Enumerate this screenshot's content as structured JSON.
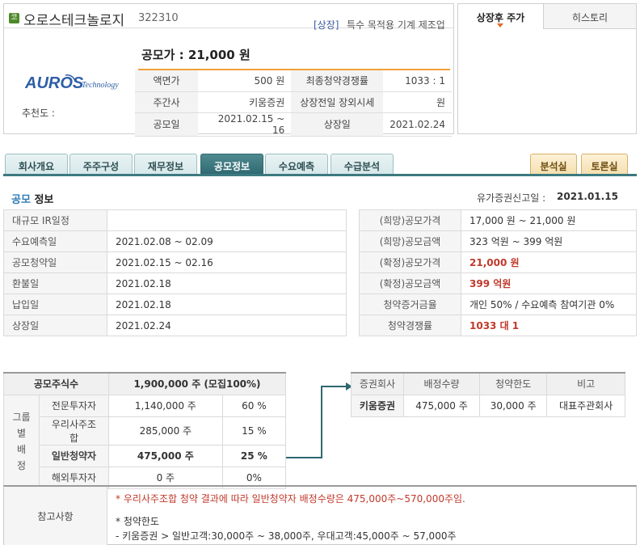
{
  "header": {
    "market_badge": "코",
    "company_name": "오로스테크놀로지",
    "company_code": "322310",
    "listing_tag": "[상장]",
    "industry": "특수 목적용 기계 제조업",
    "offer_price_label": "공모가 : 21,000 원",
    "logo_text": "AUROS",
    "logo_sub": "Technology",
    "recommend_label": "추천도 :"
  },
  "summary": {
    "rows": [
      {
        "h1": "액면가",
        "v1": "500 원",
        "h2": "최종청약경쟁률",
        "v2": "1033 : 1"
      },
      {
        "h1": "주간사",
        "v1": "키움증권",
        "h2": "상장전일 장외시세",
        "v2": "원"
      },
      {
        "h1": "공모일",
        "v1": "2021.02.15 ~ 16",
        "h2": "상장일",
        "v2": "2021.02.24"
      }
    ]
  },
  "right_panel": {
    "tab_active": "상장후 주가",
    "tab_other": "히스토리"
  },
  "tabs": {
    "items": [
      "회사개요",
      "주주구성",
      "재무정보",
      "공모정보",
      "수요예측",
      "수급분석"
    ],
    "right": [
      "분석실",
      "토론실"
    ]
  },
  "section": {
    "title_accent": "공모",
    "title_rest": " 정보",
    "filing_label": "유가증권신고일 :",
    "filing_date": "2021.01.15"
  },
  "schedule": [
    {
      "label": "대규모 IR일정",
      "value": ""
    },
    {
      "label": "수요예측일",
      "value": "2021.02.08 ~ 02.09"
    },
    {
      "label": "공모청약일",
      "value": "2021.02.15 ~ 02.16"
    },
    {
      "label": "환불일",
      "value": "2021.02.18"
    },
    {
      "label": "납입일",
      "value": "2021.02.18"
    },
    {
      "label": "상장일",
      "value": "2021.02.24"
    }
  ],
  "pricing": [
    {
      "label": "(희망)공모가격",
      "value": "17,000 원 ~ 21,000 원"
    },
    {
      "label": "(희망)공모금액",
      "value": "323 억원  ~ 399 억원"
    },
    {
      "label": "(확정)공모가격",
      "value": "21,000 원"
    },
    {
      "label": "(확정)공모금액",
      "value": "399 억원"
    },
    {
      "label": "청약증거금율",
      "value": "개인 50% / 수요예측 참여기관 0%"
    },
    {
      "label": "청약경쟁률",
      "value": "1033 대 1"
    }
  ],
  "allocation": {
    "total_label": "공모주식수",
    "total_value": "1,900,000  주 (모집100%)",
    "group_label_1": "그룹별",
    "group_label_2": "배  정",
    "rows": [
      {
        "label": "전문투자자",
        "shares": "1,140,000 주",
        "pct": "60 %"
      },
      {
        "label": "우리사주조합",
        "shares": "285,000 주",
        "pct": "15 %"
      },
      {
        "label": "일반청약자",
        "shares": "475,000 주",
        "pct": "25 %"
      },
      {
        "label": "해외투자자",
        "shares": "0 주",
        "pct": "0%"
      }
    ]
  },
  "underwriter": {
    "headers": [
      "증권회사",
      "배정수량",
      "청약한도",
      "비고"
    ],
    "row": [
      "키움증권",
      "475,000 주",
      "30,000 주",
      "대표주관회사"
    ]
  },
  "notes": {
    "label": "참고사항",
    "red": "* 우리사주조합 청약 결과에 따라 일반청약자 배정수량은 475,000주~570,000주임.",
    "line1": "* 청약한도",
    "line2": "- 키움증권 > 일반고객:30,000주 ~ 38,000주, 우대고객:45,000주 ~ 57,000주"
  }
}
